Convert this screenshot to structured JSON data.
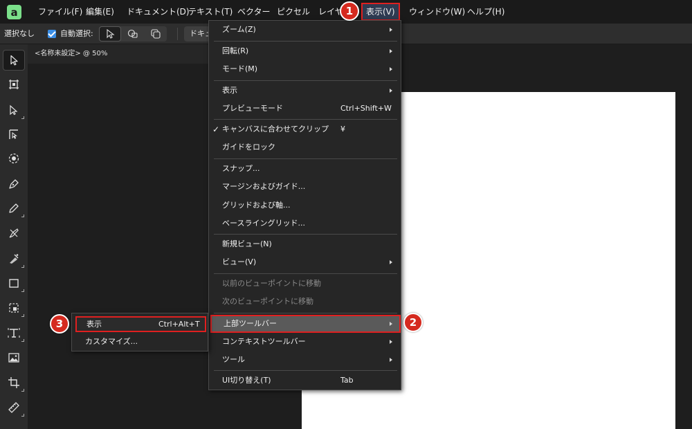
{
  "menubar": {
    "items": [
      "ファイル(F)",
      "編集(E)",
      "ドキュメント(D)",
      "テキスト(T)",
      "ベクター",
      "ピクセル",
      "レイヤー",
      "表示(V)",
      "ウィンドウ(W)",
      "ヘルプ(H)"
    ],
    "active": "表示(V)"
  },
  "context_toolbar": {
    "selection": "選択なし",
    "auto_select_label": "自動選択:",
    "auto_select_checked": true,
    "doc_button_label": "ドキュメント"
  },
  "document": {
    "tab_title": "<名称未設定> @ 50%"
  },
  "tools": [
    "move-tool",
    "artboard-tool",
    "node-tool",
    "corner-tool",
    "point-transform-tool",
    "pen-tool",
    "pencil-tool",
    "vector-brush-tool",
    "fill-tool",
    "rectangle-tool",
    "shape-tool",
    "frame-text-tool",
    "picture-frame-tool",
    "crop-tool",
    "measure-tool"
  ],
  "view_menu": {
    "items": [
      {
        "label": "ズーム(Z)",
        "submenu": true
      },
      {
        "label": "回転(R)",
        "submenu": true
      },
      {
        "label": "モード(M)",
        "submenu": true
      },
      {
        "label": "表示",
        "submenu": true
      },
      {
        "label": "プレビューモード",
        "shortcut": "Ctrl+Shift+W"
      },
      {
        "label": "キャンバスに合わせてクリップ",
        "shortcut": "¥",
        "checked": true
      },
      {
        "label": "ガイドをロック"
      },
      {
        "label": "スナップ..."
      },
      {
        "label": "マージンおよびガイド..."
      },
      {
        "label": "グリッドおよび軸..."
      },
      {
        "label": "ベースライングリッド..."
      },
      {
        "label": "新規ビュー(N)"
      },
      {
        "label": "ビュー(V)",
        "submenu": true
      },
      {
        "label": "以前のビューポイントに移動",
        "disabled": true
      },
      {
        "label": "次のビューポイントに移動",
        "disabled": true
      },
      {
        "label": "上部ツールバー",
        "submenu": true,
        "highlighted": true
      },
      {
        "label": "コンテキストツールバー",
        "submenu": true
      },
      {
        "label": "ツール",
        "submenu": true
      },
      {
        "label": "UI切り替え(T)",
        "shortcut": "Tab"
      }
    ]
  },
  "top_toolbar_submenu": {
    "items": [
      {
        "label": "表示",
        "shortcut": "Ctrl+Alt+T",
        "highlighted": true
      },
      {
        "label": "カスタマイズ..."
      }
    ]
  },
  "badges": [
    "1",
    "2",
    "3"
  ],
  "colors": {
    "accent_red": "#e02020",
    "badge_red": "#d52a1f",
    "app_logo_green": "#7be08a",
    "checkbox_blue": "#3a8ee6"
  }
}
